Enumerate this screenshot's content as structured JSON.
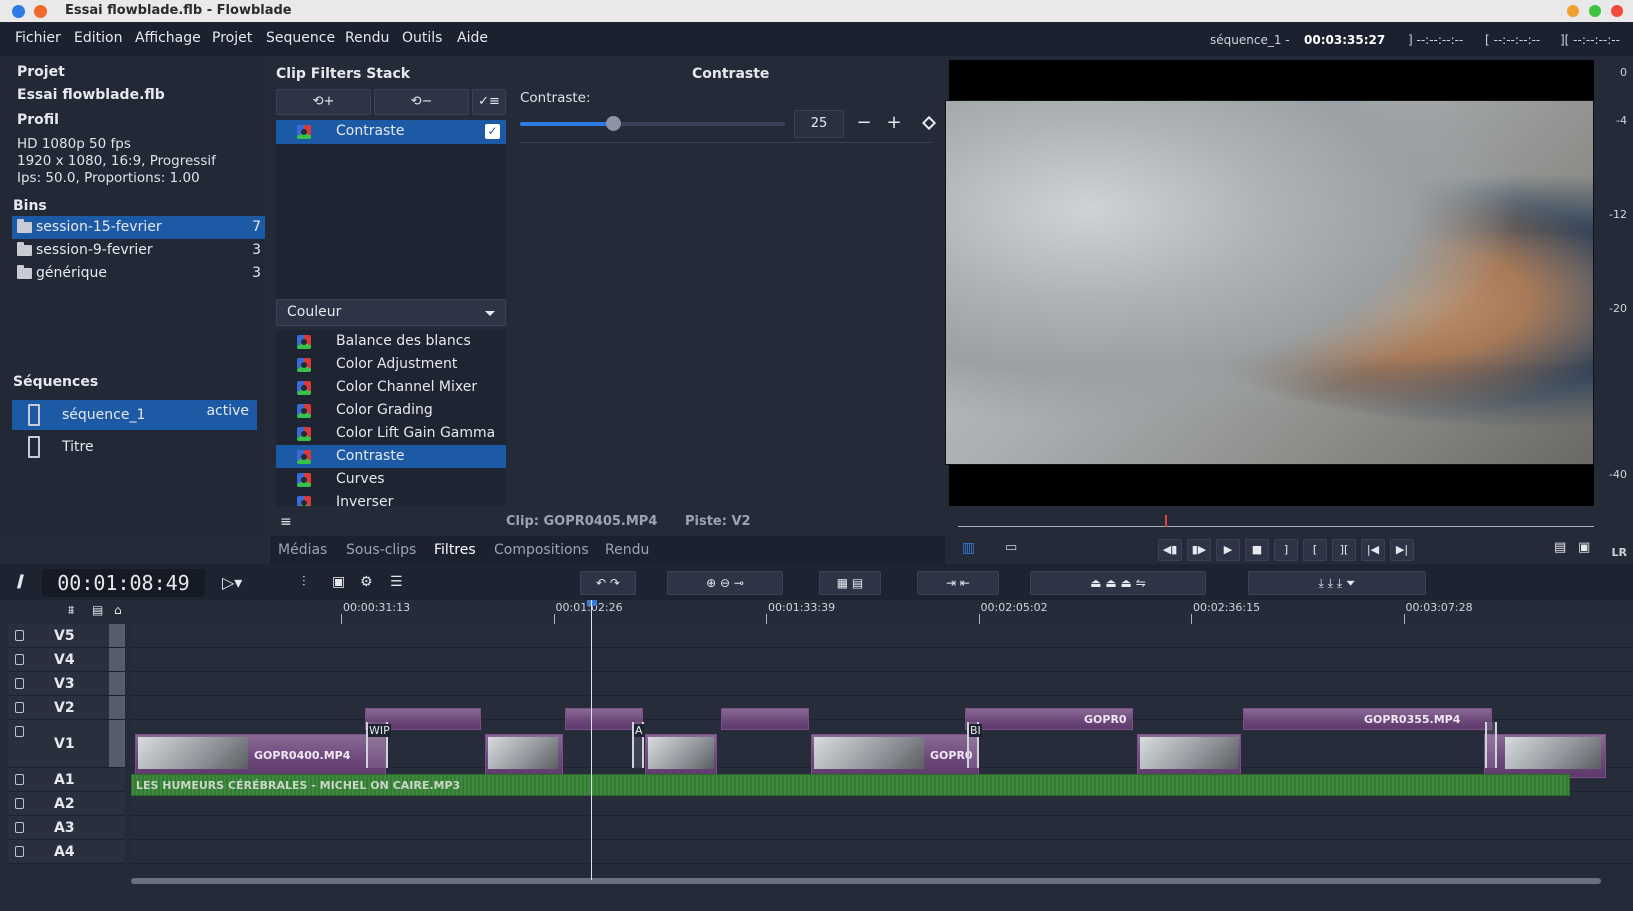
{
  "window": {
    "title": "Essai flowblade.flb - Flowblade"
  },
  "menu": [
    "Fichier",
    "Edition",
    "Affichage",
    "Projet",
    "Sequence",
    "Rendu",
    "Outils",
    "Aide"
  ],
  "status": {
    "sequence": "séquence_1 - ",
    "timecode": "00:03:35:27",
    "mark_in": "] --:--:--:--",
    "mark_out": "[ --:--:--:--",
    "length": "][ --:--:--:--"
  },
  "project": {
    "heading": "Projet",
    "name": "Essai flowblade.flb",
    "profile_heading": "Profil",
    "profile_name": "HD 1080p 50 fps",
    "profile_res": "1920 x 1080, 16:9, Progressif",
    "profile_fps": "Ips: 50.0, Proportions: 1.00"
  },
  "bins": {
    "heading": "Bins",
    "items": [
      {
        "name": "session-15-fevrier",
        "count": "7"
      },
      {
        "name": "session-9-fevrier",
        "count": "3"
      },
      {
        "name": "générique",
        "count": "3"
      }
    ]
  },
  "sequences": {
    "heading": "Séquences",
    "items": [
      {
        "name": "séquence_1",
        "state": "active"
      },
      {
        "name": "Titre",
        "state": ""
      }
    ]
  },
  "filters": {
    "stack_title": "Clip Filters Stack",
    "panel_title": "Contraste",
    "add": "+",
    "remove": "−",
    "stack_items": [
      "Contraste"
    ],
    "param_label": "Contraste:",
    "param_value": "25",
    "param_fraction": 0.25,
    "group": "Couleur",
    "list": [
      "Balance des blancs",
      "Color Adjustment",
      "Color Channel Mixer",
      "Color Grading",
      "Color Lift Gain Gamma",
      "Contraste",
      "Curves",
      "Inverser"
    ],
    "selected": "Contraste",
    "clip_info": "Clip: GOPR0405.MP4",
    "track_info": "Piste: V2"
  },
  "tabs": [
    "Médias",
    "Sous-clips",
    "Filtres",
    "Compositions",
    "Rendu"
  ],
  "active_tab": "Filtres",
  "meter": [
    "0",
    "-4",
    "-12",
    "-20",
    "-40"
  ],
  "meter_lr": "LR",
  "timeline": {
    "timecode": "00:01:08:49",
    "ruler": [
      "00:00:31:13",
      "00:01:02:26",
      "00:01:33:39",
      "00:02:05:02",
      "00:02:36:15",
      "00:03:07:28"
    ],
    "tracks": [
      "V5",
      "V4",
      "V3",
      "V2",
      "V1",
      "A1",
      "A2",
      "A3",
      "A4"
    ],
    "clip_labels": [
      "GOPR0400.MP4",
      "GOPR0",
      "GOPR0",
      "GOPR0355.MP4"
    ],
    "trans_labels": [
      "WIP",
      "A",
      "BI"
    ],
    "audio_label": "LES HUMEURS CÉRÉBRALES - MICHEL ON CAIRE.MP3"
  }
}
